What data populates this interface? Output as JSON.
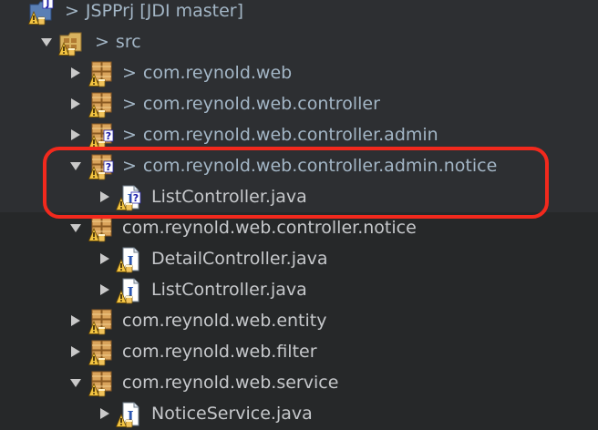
{
  "rows": [
    {
      "id": "project",
      "twisty": "none",
      "icon": "project-icon",
      "decoration": "none",
      "dirty": true,
      "prefix": ">",
      "label": "JSPPrj",
      "suffix": " [JDI master]"
    },
    {
      "id": "src",
      "twisty": "open",
      "icon": "source-folder-icon",
      "decoration": "none",
      "dirty": true,
      "prefix": ">",
      "label": "src",
      "suffix": ""
    },
    {
      "id": "pkg-web",
      "twisty": "closed",
      "icon": "package-icon",
      "decoration": "none",
      "dirty": true,
      "prefix": ">",
      "label": "com.reynold.web",
      "suffix": ""
    },
    {
      "id": "pkg-web-controller",
      "twisty": "closed",
      "icon": "package-icon",
      "decoration": "none",
      "dirty": true,
      "prefix": ">",
      "label": "com.reynold.web.controller",
      "suffix": ""
    },
    {
      "id": "pkg-web-controller-admin",
      "twisty": "closed",
      "icon": "package-icon",
      "decoration": "untracked",
      "dirty": true,
      "prefix": ">",
      "label": "com.reynold.web.controller.admin",
      "suffix": ""
    },
    {
      "id": "pkg-web-controller-admin-notice",
      "twisty": "open",
      "icon": "package-icon",
      "decoration": "untracked",
      "dirty": true,
      "prefix": ">",
      "label": "com.reynold.web.controller.admin.notice",
      "suffix": ""
    },
    {
      "id": "file-admin-listcontroller",
      "twisty": "closed",
      "icon": "java-file-icon",
      "decoration": "untracked",
      "dirty": false,
      "prefix": "",
      "label": "ListController.java",
      "suffix": ""
    },
    {
      "id": "pkg-web-controller-notice",
      "twisty": "open",
      "icon": "package-icon",
      "decoration": "none",
      "dirty": false,
      "prefix": "",
      "label": "com.reynold.web.controller.notice",
      "suffix": ""
    },
    {
      "id": "file-detailcontroller",
      "twisty": "closed",
      "icon": "java-file-icon",
      "decoration": "none",
      "dirty": false,
      "prefix": "",
      "label": "DetailController.java",
      "suffix": ""
    },
    {
      "id": "file-notice-listcontroller",
      "twisty": "closed",
      "icon": "java-file-icon",
      "decoration": "none",
      "dirty": false,
      "prefix": "",
      "label": "ListController.java",
      "suffix": ""
    },
    {
      "id": "pkg-web-entity",
      "twisty": "closed",
      "icon": "package-icon",
      "decoration": "none",
      "dirty": false,
      "prefix": "",
      "label": "com.reynold.web.entity",
      "suffix": ""
    },
    {
      "id": "pkg-web-filter",
      "twisty": "closed",
      "icon": "package-icon",
      "decoration": "none",
      "dirty": false,
      "prefix": "",
      "label": "com.reynold.web.filter",
      "suffix": ""
    },
    {
      "id": "pkg-web-service",
      "twisty": "open",
      "icon": "package-icon",
      "decoration": "none",
      "dirty": false,
      "prefix": "",
      "label": "com.reynold.web.service",
      "suffix": ""
    },
    {
      "id": "file-noticeservice",
      "twisty": "closed",
      "icon": "java-file-icon",
      "decoration": "none",
      "dirty": false,
      "prefix": "",
      "label": "NoticeService.java",
      "suffix": ""
    }
  ],
  "colors": {
    "background": "#262829",
    "dirty_label": "#a3b6c6",
    "clean_label": "#c6c8cb",
    "twisty": "#c9c9c9",
    "highlight_border": "#f2291d"
  }
}
